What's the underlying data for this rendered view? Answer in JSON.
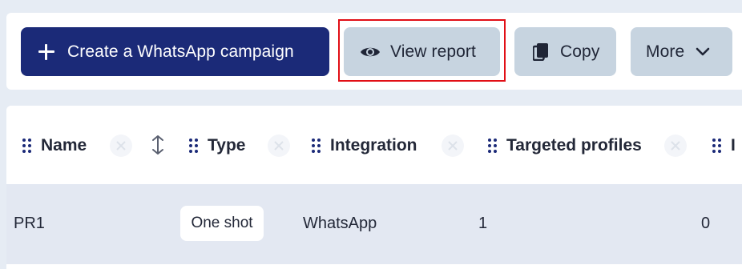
{
  "toolbar": {
    "create_label": "Create a WhatsApp campaign",
    "view_report_label": "View report",
    "copy_label": "Copy",
    "more_label": "More"
  },
  "table": {
    "columns": [
      {
        "label": "Name"
      },
      {
        "label": "Type"
      },
      {
        "label": "Integration"
      },
      {
        "label": "Targeted profiles"
      },
      {
        "label": "I"
      }
    ],
    "rows": [
      {
        "name": "PR1",
        "type": "One shot",
        "integration": "WhatsApp",
        "targeted_profiles": "1",
        "next": "0"
      }
    ]
  },
  "colors": {
    "primary": "#1b2a78",
    "secondary_button": "#c7d4e0",
    "highlight": "#e10f16",
    "row_background": "#e3e8f2"
  },
  "icons": [
    "plus-icon",
    "eye-icon",
    "copy-icon",
    "chevron-down-icon",
    "drag-handle-icon",
    "close-icon",
    "sort-icon"
  ]
}
